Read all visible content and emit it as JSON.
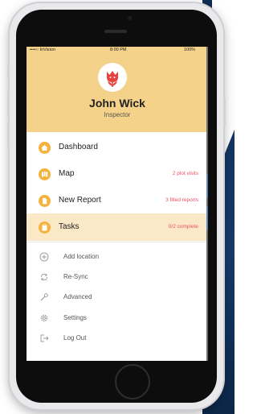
{
  "statusbar": {
    "carrier": "••••○ InVision",
    "time": "8:00 PM",
    "battery": "100%"
  },
  "profile": {
    "name": "John Wick",
    "role": "Inspector"
  },
  "menu": [
    {
      "label": "Dashboard",
      "meta": ""
    },
    {
      "label": "Map",
      "meta": "2 plot visits"
    },
    {
      "label": "New Report",
      "meta": "3 filled reports"
    },
    {
      "label": "Tasks",
      "meta": "0/2 complete"
    }
  ],
  "secondary": [
    {
      "label": "Add location",
      "icon": "plus-circle-icon"
    },
    {
      "label": "Re-Sync",
      "icon": "sync-icon"
    },
    {
      "label": "Advanced",
      "icon": "wrench-icon"
    },
    {
      "label": "Settings",
      "icon": "gear-icon"
    },
    {
      "label": "Log Out",
      "icon": "logout-icon"
    }
  ],
  "colors": {
    "header": "#f5d289",
    "accent_icon": "#f3b33d",
    "meta_text": "#ef4e62",
    "active_row": "#fbe8c6",
    "avatar_flower": "#e8413d"
  }
}
